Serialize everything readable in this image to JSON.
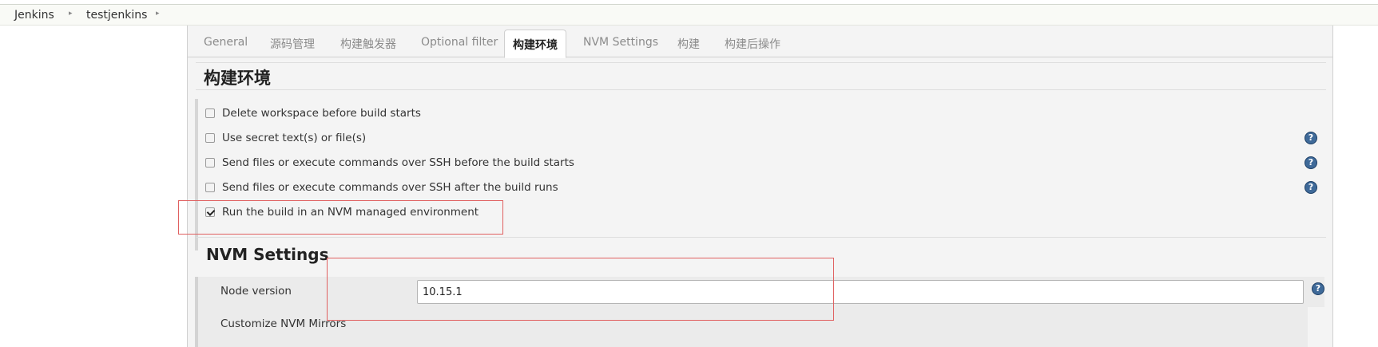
{
  "breadcrumb": {
    "items": [
      "Jenkins",
      "testjenkins"
    ],
    "separator": "▸"
  },
  "tabs": [
    {
      "label": "General",
      "active": false
    },
    {
      "label": "源码管理",
      "active": false
    },
    {
      "label": "构建触发器",
      "active": false
    },
    {
      "label": "Optional filter",
      "active": false
    },
    {
      "label": "构建环境",
      "active": true
    },
    {
      "label": "NVM Settings",
      "active": false
    },
    {
      "label": "构建",
      "active": false
    },
    {
      "label": "构建后操作",
      "active": false
    }
  ],
  "build_env": {
    "title": "构建环境",
    "options": [
      {
        "label": "Delete workspace before build starts",
        "checked": false,
        "help": false
      },
      {
        "label": "Use secret text(s) or file(s)",
        "checked": false,
        "help": true
      },
      {
        "label": "Send files or execute commands over SSH before the build starts",
        "checked": false,
        "help": true
      },
      {
        "label": "Send files or execute commands over SSH after the build runs",
        "checked": false,
        "help": true
      },
      {
        "label": "Run the build in an NVM managed environment",
        "checked": true,
        "help": false
      }
    ]
  },
  "nvm_settings": {
    "title": "NVM Settings",
    "node_version_label": "Node version",
    "node_version_value": "10.15.1",
    "mirrors_label": "Customize NVM Mirrors"
  },
  "icons": {
    "help": "help-icon",
    "checkbox_checked": "checkmark-icon",
    "breadcrumb_separator": "chevron-right-icon"
  },
  "colors": {
    "highlight_box": "#e06060",
    "help_icon": "#3f6a99",
    "panel_bg": "#f4f4f4"
  }
}
